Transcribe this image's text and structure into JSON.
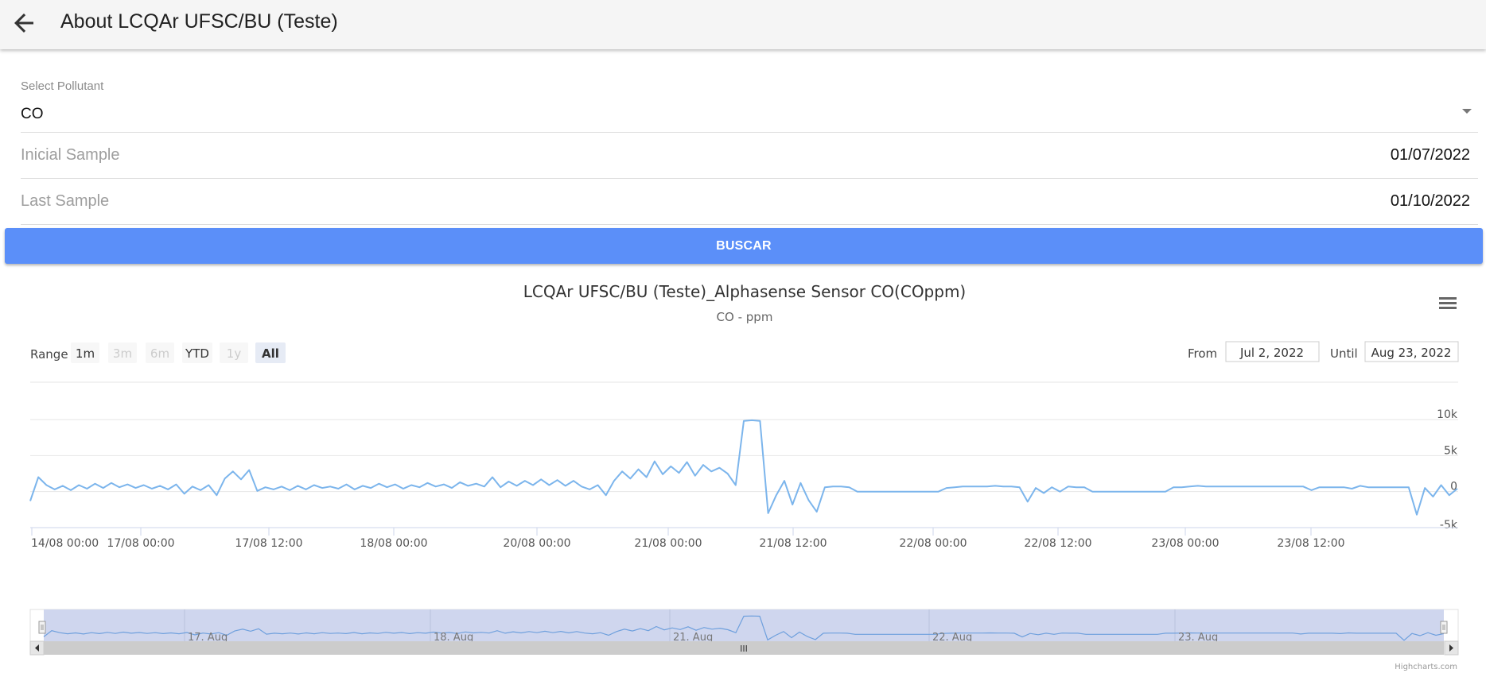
{
  "app": {
    "title": "About LCQAr UFSC/BU (Teste)"
  },
  "form": {
    "pollutant_label": "Select Pollutant",
    "pollutant_value": "CO",
    "initial_label": "Inicial Sample",
    "initial_value": "01/07/2022",
    "last_label": "Last Sample",
    "last_value": "01/10/2022",
    "search_label": "BUSCAR"
  },
  "chart": {
    "range_label": "Range",
    "range_buttons": [
      {
        "label": "1m",
        "state": "enabled"
      },
      {
        "label": "3m",
        "state": "disabled"
      },
      {
        "label": "6m",
        "state": "disabled"
      },
      {
        "label": "YTD",
        "state": "enabled"
      },
      {
        "label": "1y",
        "state": "disabled"
      },
      {
        "label": "All",
        "state": "selected"
      }
    ],
    "from_label": "From",
    "from_value": "Jul 2, 2022",
    "until_label": "Until",
    "until_value": "Aug 23, 2022",
    "credit": "Highcharts.com",
    "navigator_labels": [
      "17. Aug",
      "18. Aug",
      "21. Aug",
      "22. Aug",
      "23. Aug"
    ],
    "scrollbar_grip": "III"
  },
  "chart_data": {
    "type": "line",
    "title": "LCQAr UFSC/BU (Teste)_Alphasense Sensor CO(COppm)",
    "subtitle": "CO - ppm",
    "x_tick_labels": [
      "14/08 00:00",
      "17/08 00:00",
      "17/08 12:00",
      "18/08 00:00",
      "20/08 00:00",
      "21/08 00:00",
      "21/08 12:00",
      "22/08 00:00",
      "22/08 12:00",
      "23/08 00:00",
      "23/08 12:00"
    ],
    "y_tick_labels": [
      "10k",
      "5k",
      "0",
      "-5k"
    ],
    "ylim": [
      -5000,
      10000
    ],
    "grid": true,
    "series": [
      {
        "values": [
          -1300,
          2000,
          900,
          300,
          800,
          200,
          900,
          400,
          1100,
          500,
          1200,
          600,
          1000,
          500,
          900,
          400,
          800,
          300,
          1000,
          -300,
          700,
          200,
          900,
          -500,
          1800,
          2800,
          1700,
          3000,
          100,
          600,
          300,
          700,
          200,
          800,
          300,
          900,
          500,
          700,
          400,
          1000,
          300,
          800,
          500,
          1100,
          600,
          1000,
          400,
          900,
          600,
          1200,
          700,
          1000,
          500,
          1300,
          800,
          1100,
          700,
          2000,
          600,
          1400,
          800,
          1500,
          900,
          1700,
          900,
          1600,
          800,
          1500,
          700,
          300,
          900,
          -500,
          1500,
          2800,
          1800,
          3100,
          2000,
          4200,
          2400,
          3500,
          2600,
          4100,
          2200,
          3700,
          2800,
          3300,
          2500,
          900,
          9800,
          9900,
          9800,
          -3000,
          -500,
          1500,
          -1800,
          1200,
          -1200,
          -2800,
          600,
          700,
          700,
          600,
          0,
          0,
          0,
          0,
          0,
          0,
          0,
          0,
          0,
          0,
          0,
          500,
          600,
          700,
          700,
          700,
          700,
          800,
          700,
          700,
          600,
          -1400,
          500,
          -200,
          600,
          0,
          700,
          600,
          600,
          0,
          0,
          0,
          0,
          0,
          0,
          0,
          0,
          0,
          0,
          600,
          600,
          700,
          800,
          700,
          700,
          700,
          700,
          700,
          700,
          700,
          700,
          700,
          700,
          700,
          700,
          700,
          200,
          600,
          600,
          600,
          600,
          400,
          800,
          600,
          600,
          600,
          600,
          600,
          600,
          -3200,
          500,
          -700,
          900,
          -500,
          400
        ]
      }
    ]
  }
}
